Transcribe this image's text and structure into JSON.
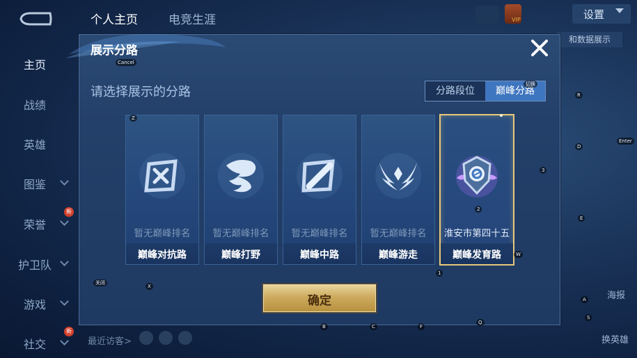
{
  "top_tabs": [
    {
      "label": "个人主页",
      "active": true
    },
    {
      "label": "电竞生涯",
      "active": false
    }
  ],
  "settings": {
    "label": "设置"
  },
  "vip_text": "VIP",
  "sidebar": {
    "items": [
      {
        "label": "主页",
        "active": true,
        "chevron": false,
        "badge": ""
      },
      {
        "label": "战绩",
        "active": false,
        "chevron": false,
        "badge": ""
      },
      {
        "label": "英雄",
        "active": false,
        "chevron": false,
        "badge": ""
      },
      {
        "label": "图鉴",
        "active": false,
        "chevron": true,
        "badge": ""
      },
      {
        "label": "荣誉",
        "active": false,
        "chevron": true,
        "badge": "新"
      },
      {
        "label": "护卫队",
        "active": false,
        "chevron": true,
        "badge": ""
      },
      {
        "label": "游戏",
        "active": false,
        "chevron": true,
        "badge": ""
      },
      {
        "label": "社交",
        "active": false,
        "chevron": true,
        "badge": "新"
      }
    ]
  },
  "background": {
    "right_tag": "和数据展示",
    "haibao_label": "海报",
    "change_hero_label": "换英雄",
    "recent_visitors": "最近访客>"
  },
  "key_hints": {
    "cancel": "Cancel",
    "z": "Z",
    "x": "X",
    "r": "R",
    "d": "D",
    "e": "E",
    "three": "3",
    "two": "2",
    "one": "1",
    "w": "W",
    "q": "Q",
    "a": "A",
    "s": "S",
    "b": "B",
    "c": "C",
    "f": "F",
    "enter": "Enter",
    "close_hint": "关闭",
    "toggle_hint": "切换"
  },
  "modal": {
    "title": "展示分路",
    "prompt": "请选择展示的分路",
    "toggle": [
      {
        "label": "分路段位",
        "selected": false
      },
      {
        "label": "巅峰分路",
        "selected": true
      }
    ],
    "cards": [
      {
        "rank": "暂无巅峰排名",
        "name": "巅峰对抗路",
        "emblem": "sword-shield-icon",
        "selected": false
      },
      {
        "rank": "暂无巅峰排名",
        "name": "巅峰打野",
        "emblem": "dragon-icon",
        "selected": false
      },
      {
        "rank": "暂无巅峰排名",
        "name": "巅峰中路",
        "emblem": "slash-staff-icon",
        "selected": false
      },
      {
        "rank": "暂无巅峰排名",
        "name": "巅峰游走",
        "emblem": "wings-icon",
        "selected": false
      },
      {
        "rank": "淮安市第四十五",
        "name": "巅峰发育路",
        "emblem": "crest-badge-icon",
        "selected": true
      }
    ],
    "confirm_label": "确定"
  },
  "colors": {
    "accent_gold": "#e9c97a",
    "toggle_selected": "#3f76c0"
  }
}
